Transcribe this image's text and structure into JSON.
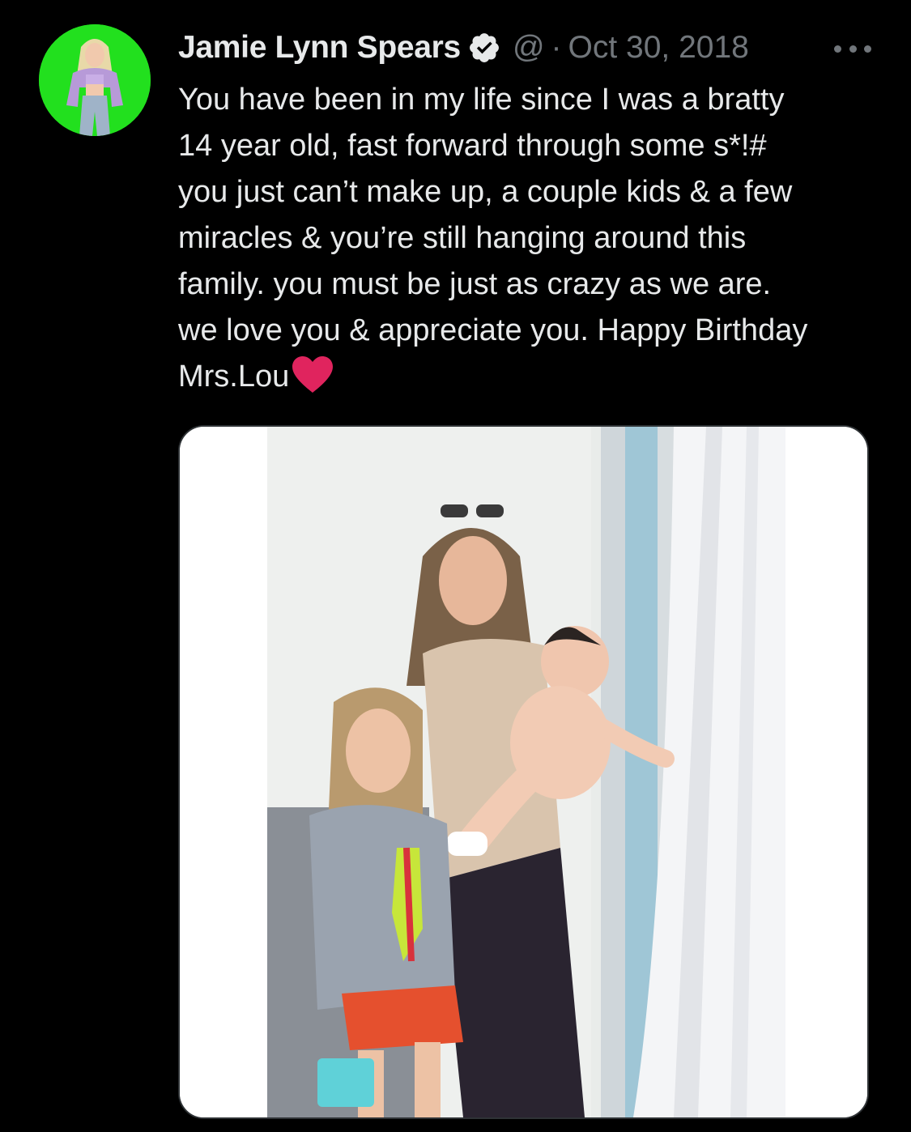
{
  "tweet": {
    "author": {
      "name": "Jamie Lynn Spears",
      "verified": true,
      "verified_icon": "verified-badge-icon",
      "handle": "@",
      "separator": "·",
      "date": "Oct 30, 2018",
      "avatar_bg": "#22e01e"
    },
    "more_icon": "more-options-icon",
    "text_lines": [
      "You have been in my life since I was a bratty",
      "14 year old, fast forward through some s*!#",
      "you just can’t make up, a couple kids & a few",
      "miracles & you’re still hanging around this",
      "family. you must be just as crazy as we are.",
      "we love you & appreciate you. Happy Birthday",
      "Mrs.Lou"
    ],
    "emoji": "heart-emoji",
    "emoji_color": "#e0245e",
    "media": {
      "type": "photo",
      "border_color": "#2f3336"
    }
  },
  "colors": {
    "background": "#000000",
    "primary_text": "#e7e9ea",
    "secondary_text": "#71767b"
  }
}
